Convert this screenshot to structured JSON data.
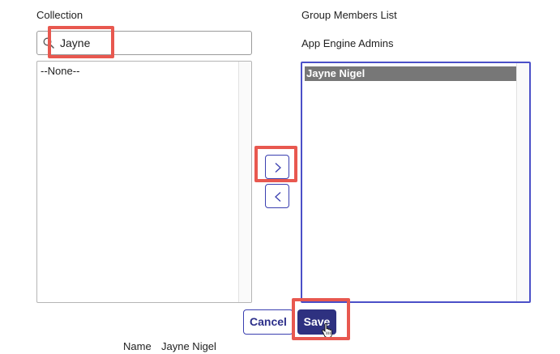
{
  "collection": {
    "label": "Collection",
    "search_value": "Jayne",
    "options": [
      "--None--"
    ]
  },
  "members": {
    "label": "Group Members List",
    "group_name": "App Engine Admins",
    "options": [
      "Jayne Nigel"
    ]
  },
  "controls": {
    "add_arrow": "›",
    "remove_arrow": "‹"
  },
  "buttons": {
    "cancel": "Cancel",
    "save": "Save"
  },
  "footer": {
    "name_label": "Name",
    "name_value": "Jayne Nigel"
  },
  "icons": {
    "search": "search-icon",
    "add": "chevron-right-icon",
    "remove": "chevron-left-icon",
    "cursor": "hand-pointer-icon"
  },
  "colors": {
    "primary": "#2e3180",
    "accent_border": "#4b50c8",
    "highlight": "#e8584f",
    "selected_bg": "#777777"
  }
}
